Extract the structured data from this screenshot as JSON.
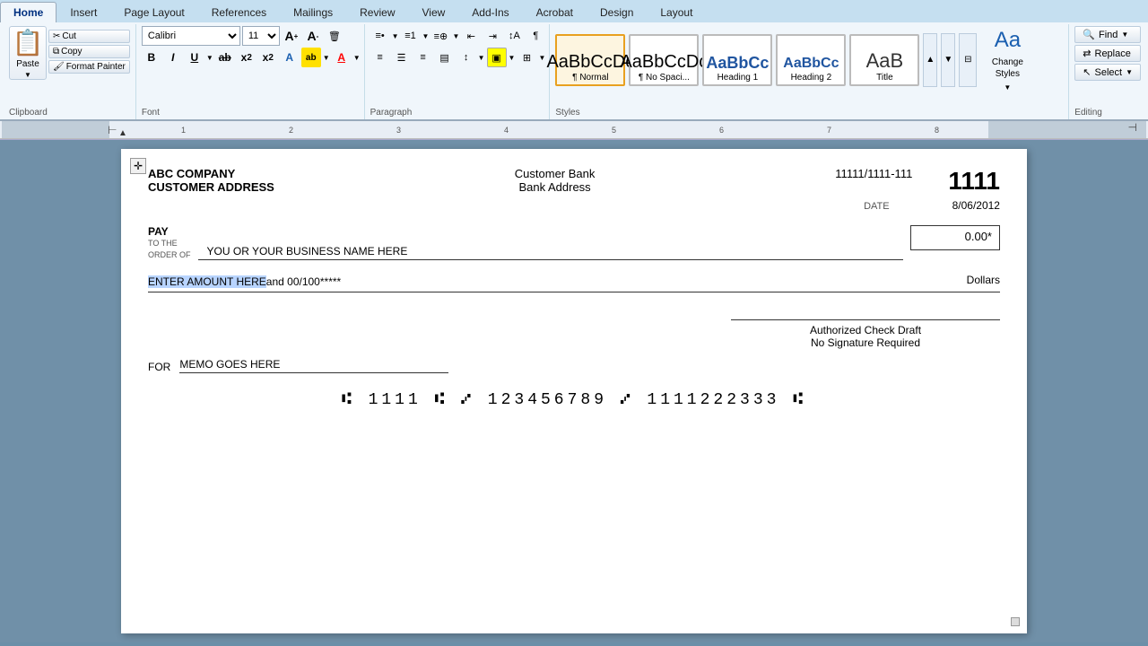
{
  "tabs": [
    {
      "label": "Home",
      "active": true
    },
    {
      "label": "Insert",
      "active": false
    },
    {
      "label": "Page Layout",
      "active": false
    },
    {
      "label": "References",
      "active": false
    },
    {
      "label": "Mailings",
      "active": false
    },
    {
      "label": "Review",
      "active": false
    },
    {
      "label": "View",
      "active": false
    },
    {
      "label": "Add-Ins",
      "active": false
    },
    {
      "label": "Acrobat",
      "active": false
    },
    {
      "label": "Design",
      "active": false
    },
    {
      "label": "Layout",
      "active": false
    }
  ],
  "ribbon": {
    "clipboard": {
      "paste_label": "Paste",
      "cut_label": "Cut",
      "copy_label": "Copy",
      "format_painter_label": "Format Painter",
      "group_label": "Clipboard"
    },
    "font": {
      "font_name": "Calibri",
      "font_size": "11",
      "group_label": "Font"
    },
    "paragraph": {
      "group_label": "Paragraph"
    },
    "styles": {
      "group_label": "Styles",
      "items": [
        {
          "label": "¶ Normal",
          "preview": "AaBbCcDc",
          "type": "normal"
        },
        {
          "label": "¶ No Spaci...",
          "preview": "AaBbCcDc",
          "type": "nospace"
        },
        {
          "label": "Heading 1",
          "preview": "AaBbCc",
          "type": "h1"
        },
        {
          "label": "Heading 2",
          "preview": "AaBbCc",
          "type": "h2"
        },
        {
          "label": "Title",
          "preview": "AaB",
          "type": "title"
        }
      ],
      "change_styles_label": "Change\nStyles"
    },
    "editing": {
      "group_label": "Editing",
      "find_label": "Find",
      "replace_label": "Replace",
      "select_label": "Select"
    }
  },
  "check": {
    "company": "ABC COMPANY",
    "address": "CUSTOMER ADDRESS",
    "bank_name": "Customer Bank",
    "bank_address": "Bank Address",
    "routing": "11111/1111-111",
    "check_number": "1111",
    "date_label": "DATE",
    "date_value": "8/06/2012",
    "pay_label": "PAY",
    "pay_to_label_line1": "TO THE",
    "pay_to_label_line2": "ORDER OF",
    "payee": "YOU OR YOUR BUSINESS NAME HERE",
    "amount": "0.00*",
    "amount_words": "ENTER AMOUNT HERE",
    "amount_words_rest": " and 00/100*****",
    "dollars_label": "Dollars",
    "authorized_line1": "Authorized Check Draft",
    "authorized_line2": "No Signature Required",
    "for_label": "FOR",
    "memo": "MEMO GOES HERE",
    "micr_line": "⑆ 1111 ⑆    ⑇ 123456789 ⑇    1111222333 ⑆"
  }
}
